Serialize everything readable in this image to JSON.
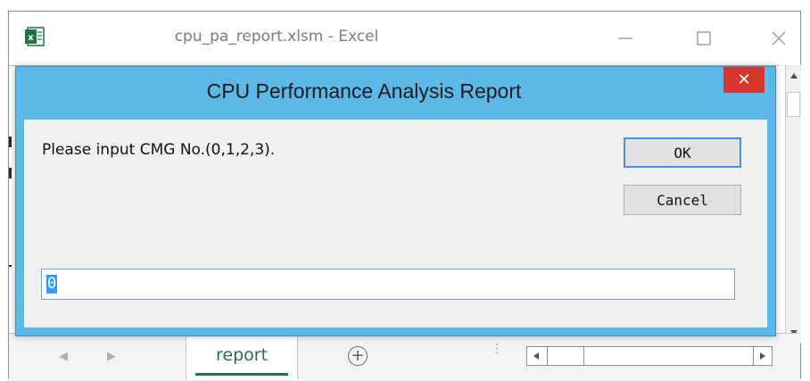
{
  "excel": {
    "window_title": "cpu_pa_report.xlsm - Excel",
    "sheet_tabs": [
      {
        "label": "report",
        "active": true
      }
    ],
    "accent_color": "#217346"
  },
  "dialog": {
    "title": "CPU Performance Analysis Report",
    "prompt": "Please input CMG No.(0,1,2,3).",
    "ok_label": "OK",
    "cancel_label": "Cancel",
    "input_value": "0",
    "close_symbol": "✕",
    "title_bar_color": "#5cb8e6",
    "close_button_color": "#d9362d"
  },
  "icons": {
    "excel_logo": "excel-logo-icon",
    "minimize": "minimize-icon",
    "maximize": "maximize-icon",
    "close": "close-icon",
    "add_sheet": "plus-circle-icon",
    "scroll_up": "triangle-up-icon",
    "scroll_down": "triangle-down-icon",
    "scroll_left": "triangle-left-icon",
    "scroll_right": "triangle-right-icon"
  },
  "symbols": {
    "add_sheet": "+",
    "nav_prev": "◀",
    "nav_next": "▶",
    "splitter": "⋮"
  }
}
